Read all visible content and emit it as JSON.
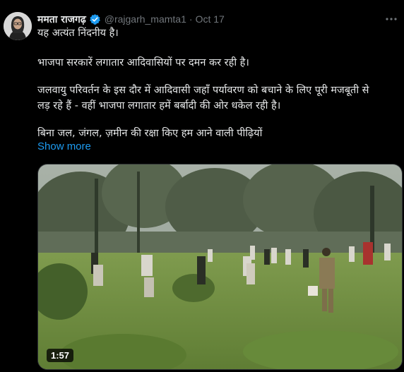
{
  "tweet": {
    "author_name": "ममता राजगढ़",
    "handle": "@rajgarh_mamta1",
    "separator": "·",
    "date": "Oct 17",
    "lines": [
      "यह अत्यंत निंदनीय है।",
      "भाजपा सरकारें लगातार आदिवासियों पर दमन कर रही है।",
      "जलवायु परिवर्तन के इस दौर में आदिवासी जहाँ पर्यावरण को बचाने के लिए पूरी मजबूती से",
      "लड़ रहे हैं - वहीं भाजपा लगातार हमें बर्बादी की ओर धकेल रही है।",
      "बिना जल, जंगल, ज़मीन की रक्षा किए हम आने वाली पीढ़ियों"
    ],
    "show_more": "Show more",
    "video": {
      "duration": "1:57"
    }
  },
  "colors": {
    "background": "#000000",
    "text": "#e7e9ea",
    "secondary": "#71767b",
    "link": "#1d9bf0",
    "verified": "#1d9bf0"
  },
  "icons": {
    "verified": "verified-badge-icon",
    "more": "more-options-icon"
  }
}
